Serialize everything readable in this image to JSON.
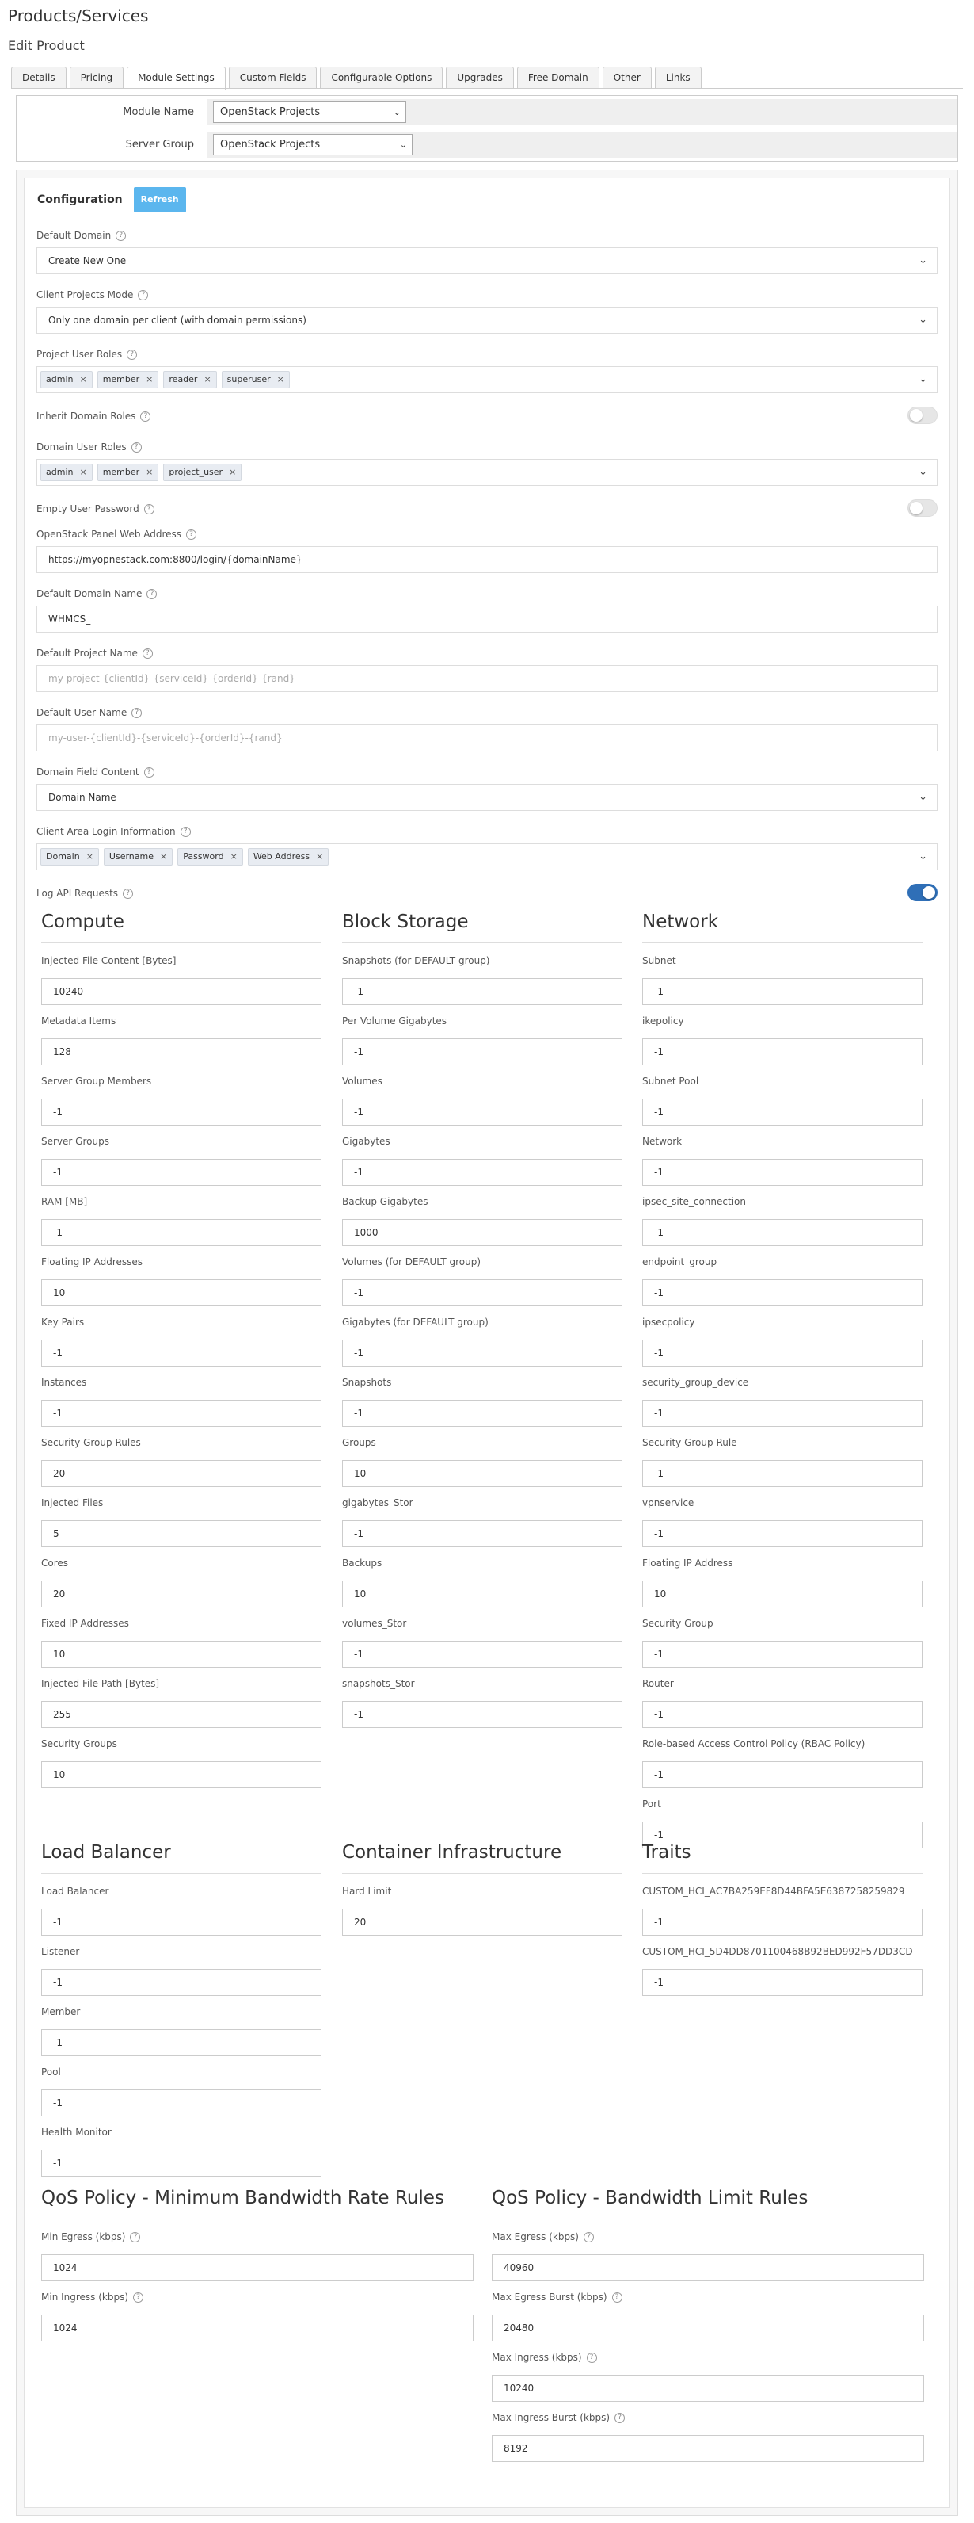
{
  "page": {
    "title": "Products/Services",
    "subtitle": "Edit Product"
  },
  "tabs": [
    "Details",
    "Pricing",
    "Module Settings",
    "Custom Fields",
    "Configurable Options",
    "Upgrades",
    "Free Domain",
    "Other",
    "Links"
  ],
  "active_tab": "Module Settings",
  "module": {
    "name_label": "Module Name",
    "name_value": "OpenStack Projects",
    "group_label": "Server Group",
    "group_value": "OpenStack Projects"
  },
  "config": {
    "title": "Configuration",
    "refresh_label": "Refresh",
    "default_domain": {
      "label": "Default Domain",
      "value": "Create New One"
    },
    "client_projects_mode": {
      "label": "Client Projects Mode",
      "value": "Only one domain per client (with domain permissions)"
    },
    "project_user_roles": {
      "label": "Project User Roles",
      "tags": [
        "admin",
        "member",
        "reader",
        "superuser"
      ]
    },
    "inherit_domain_roles": {
      "label": "Inherit Domain Roles",
      "on": false
    },
    "domain_user_roles": {
      "label": "Domain User Roles",
      "tags": [
        "admin",
        "member",
        "project_user"
      ]
    },
    "empty_user_password": {
      "label": "Empty User Password",
      "on": false
    },
    "panel_address": {
      "label": "OpenStack Panel Web Address",
      "value": "https://myopnestack.com:8800/login/{domainName}"
    },
    "default_domain_name": {
      "label": "Default Domain Name",
      "value": "WHMCS_"
    },
    "default_project_name": {
      "label": "Default Project Name",
      "placeholder": "my-project-{clientId}-{serviceId}-{orderId}-{rand}"
    },
    "default_user_name": {
      "label": "Default User Name",
      "placeholder": "my-user-{clientId}-{serviceId}-{orderId}-{rand}"
    },
    "domain_field_content": {
      "label": "Domain Field Content",
      "value": "Domain Name"
    },
    "client_area_login": {
      "label": "Client Area Login Information",
      "tags": [
        "Domain",
        "Username",
        "Password",
        "Web Address"
      ]
    },
    "log_api_requests": {
      "label": "Log API Requests",
      "on": true
    }
  },
  "sections": [
    {
      "title": "Compute",
      "fields": [
        {
          "label": "Injected File Content [Bytes]",
          "value": "10240"
        },
        {
          "label": "Metadata Items",
          "value": "128"
        },
        {
          "label": "Server Group Members",
          "value": "-1"
        },
        {
          "label": "Server Groups",
          "value": "-1"
        },
        {
          "label": "RAM [MB]",
          "value": "-1"
        },
        {
          "label": "Floating IP Addresses",
          "value": "10"
        },
        {
          "label": "Key Pairs",
          "value": "-1"
        },
        {
          "label": "Instances",
          "value": "-1"
        },
        {
          "label": "Security Group Rules",
          "value": "20"
        },
        {
          "label": "Injected Files",
          "value": "5"
        },
        {
          "label": "Cores",
          "value": "20"
        },
        {
          "label": "Fixed IP Addresses",
          "value": "10"
        },
        {
          "label": "Injected File Path [Bytes]",
          "value": "255"
        },
        {
          "label": "Security Groups",
          "value": "10"
        }
      ]
    },
    {
      "title": "Block Storage",
      "fields": [
        {
          "label": "Snapshots (for DEFAULT group)",
          "value": "-1"
        },
        {
          "label": "Per Volume Gigabytes",
          "value": "-1"
        },
        {
          "label": "Volumes",
          "value": "-1"
        },
        {
          "label": "Gigabytes",
          "value": "-1"
        },
        {
          "label": "Backup Gigabytes",
          "value": "1000"
        },
        {
          "label": "Volumes (for DEFAULT group)",
          "value": "-1"
        },
        {
          "label": "Gigabytes (for DEFAULT group)",
          "value": "-1"
        },
        {
          "label": "Snapshots",
          "value": "-1"
        },
        {
          "label": "Groups",
          "value": "10"
        },
        {
          "label": "gigabytes_Stor",
          "value": "-1"
        },
        {
          "label": "Backups",
          "value": "10"
        },
        {
          "label": "volumes_Stor",
          "value": "-1"
        },
        {
          "label": "snapshots_Stor",
          "value": "-1"
        }
      ]
    },
    {
      "title": "Network",
      "fields": [
        {
          "label": "Subnet",
          "value": "-1"
        },
        {
          "label": "ikepolicy",
          "value": "-1"
        },
        {
          "label": "Subnet Pool",
          "value": "-1"
        },
        {
          "label": "Network",
          "value": "-1"
        },
        {
          "label": "ipsec_site_connection",
          "value": "-1"
        },
        {
          "label": "endpoint_group",
          "value": "-1"
        },
        {
          "label": "ipsecpolicy",
          "value": "-1"
        },
        {
          "label": "security_group_device",
          "value": "-1"
        },
        {
          "label": "Security Group Rule",
          "value": "-1"
        },
        {
          "label": "vpnservice",
          "value": "-1"
        },
        {
          "label": "Floating IP Address",
          "value": "10"
        },
        {
          "label": "Security Group",
          "value": "-1"
        },
        {
          "label": "Router",
          "value": "-1"
        },
        {
          "label": "Role-based Access Control Policy (RBAC Policy)",
          "value": "-1"
        },
        {
          "label": "Port",
          "value": "-1"
        }
      ]
    },
    {
      "title": "Load Balancer",
      "fields": [
        {
          "label": "Load Balancer",
          "value": "-1"
        },
        {
          "label": "Listener",
          "value": "-1"
        },
        {
          "label": "Member",
          "value": "-1"
        },
        {
          "label": "Pool",
          "value": "-1"
        },
        {
          "label": "Health Monitor",
          "value": "-1"
        }
      ]
    },
    {
      "title": "Container Infrastructure",
      "fields": [
        {
          "label": "Hard Limit",
          "value": "20"
        }
      ]
    },
    {
      "title": "Traits",
      "fields": [
        {
          "label": "CUSTOM_HCI_AC7BA259EF8D44BFA5E6387258259829",
          "value": "-1"
        },
        {
          "label": "CUSTOM_HCI_5D4DD8701100468B92BED992F57DD3CD",
          "value": "-1"
        }
      ]
    },
    {
      "title": "QoS Policy - Minimum Bandwidth Rate Rules",
      "fields": [
        {
          "label": "Min Egress (kbps)",
          "value": "1024",
          "help": true
        },
        {
          "label": "Min Ingress (kbps)",
          "value": "1024",
          "help": true
        }
      ]
    },
    {
      "title": "QoS Policy - Bandwidth Limit Rules",
      "fields": [
        {
          "label": "Max Egress (kbps)",
          "value": "40960",
          "help": true
        },
        {
          "label": "Max Egress Burst (kbps)",
          "value": "20480",
          "help": true
        },
        {
          "label": "Max Ingress (kbps)",
          "value": "10240",
          "help": true
        },
        {
          "label": "Max Ingress Burst (kbps)",
          "value": "8192",
          "help": true
        }
      ]
    }
  ]
}
